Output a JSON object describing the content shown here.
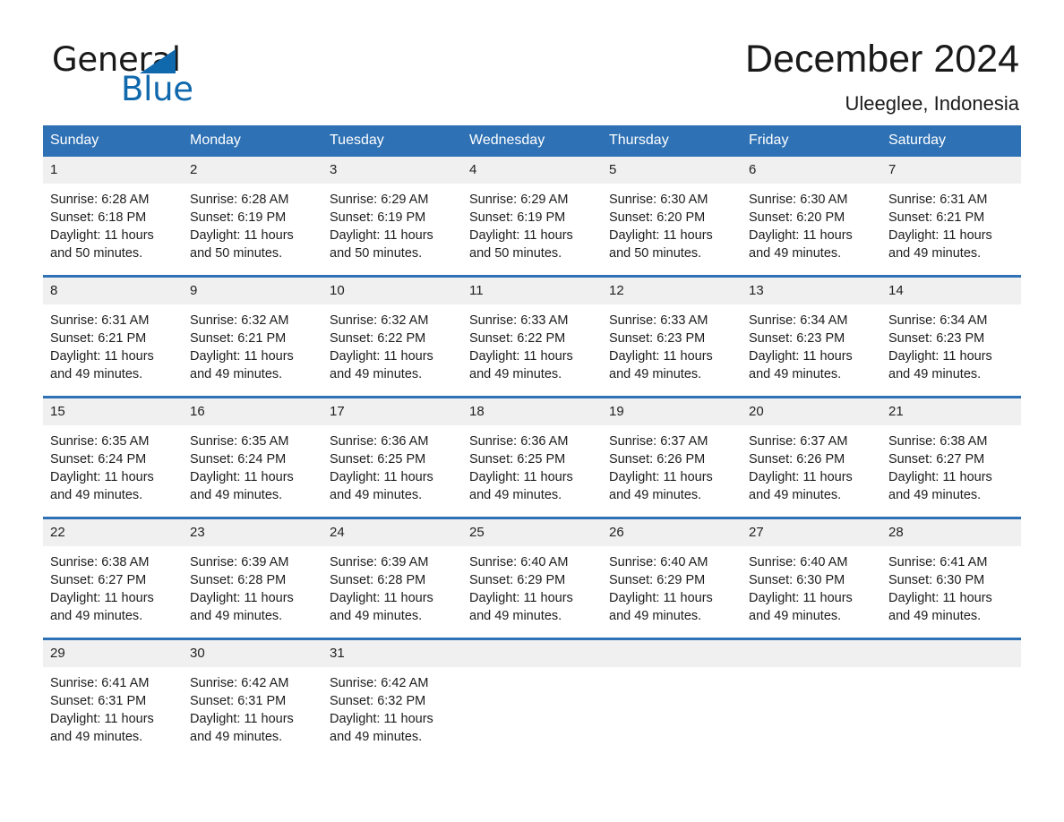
{
  "logo": {
    "word_one": "General",
    "word_two": "Blue",
    "triangle_color": "#1068ad"
  },
  "header": {
    "month_title": "December 2024",
    "location": "Uleeglee, Indonesia",
    "accent_color": "#2e71b5",
    "daynum_band_color": "#f0f0f0"
  },
  "weekdays": [
    "Sunday",
    "Monday",
    "Tuesday",
    "Wednesday",
    "Thursday",
    "Friday",
    "Saturday"
  ],
  "weeks": [
    [
      {
        "day": "1",
        "sunrise": "Sunrise: 6:28 AM",
        "sunset": "Sunset: 6:18 PM",
        "daylight_1": "Daylight: 11 hours",
        "daylight_2": "and 50 minutes."
      },
      {
        "day": "2",
        "sunrise": "Sunrise: 6:28 AM",
        "sunset": "Sunset: 6:19 PM",
        "daylight_1": "Daylight: 11 hours",
        "daylight_2": "and 50 minutes."
      },
      {
        "day": "3",
        "sunrise": "Sunrise: 6:29 AM",
        "sunset": "Sunset: 6:19 PM",
        "daylight_1": "Daylight: 11 hours",
        "daylight_2": "and 50 minutes."
      },
      {
        "day": "4",
        "sunrise": "Sunrise: 6:29 AM",
        "sunset": "Sunset: 6:19 PM",
        "daylight_1": "Daylight: 11 hours",
        "daylight_2": "and 50 minutes."
      },
      {
        "day": "5",
        "sunrise": "Sunrise: 6:30 AM",
        "sunset": "Sunset: 6:20 PM",
        "daylight_1": "Daylight: 11 hours",
        "daylight_2": "and 50 minutes."
      },
      {
        "day": "6",
        "sunrise": "Sunrise: 6:30 AM",
        "sunset": "Sunset: 6:20 PM",
        "daylight_1": "Daylight: 11 hours",
        "daylight_2": "and 49 minutes."
      },
      {
        "day": "7",
        "sunrise": "Sunrise: 6:31 AM",
        "sunset": "Sunset: 6:21 PM",
        "daylight_1": "Daylight: 11 hours",
        "daylight_2": "and 49 minutes."
      }
    ],
    [
      {
        "day": "8",
        "sunrise": "Sunrise: 6:31 AM",
        "sunset": "Sunset: 6:21 PM",
        "daylight_1": "Daylight: 11 hours",
        "daylight_2": "and 49 minutes."
      },
      {
        "day": "9",
        "sunrise": "Sunrise: 6:32 AM",
        "sunset": "Sunset: 6:21 PM",
        "daylight_1": "Daylight: 11 hours",
        "daylight_2": "and 49 minutes."
      },
      {
        "day": "10",
        "sunrise": "Sunrise: 6:32 AM",
        "sunset": "Sunset: 6:22 PM",
        "daylight_1": "Daylight: 11 hours",
        "daylight_2": "and 49 minutes."
      },
      {
        "day": "11",
        "sunrise": "Sunrise: 6:33 AM",
        "sunset": "Sunset: 6:22 PM",
        "daylight_1": "Daylight: 11 hours",
        "daylight_2": "and 49 minutes."
      },
      {
        "day": "12",
        "sunrise": "Sunrise: 6:33 AM",
        "sunset": "Sunset: 6:23 PM",
        "daylight_1": "Daylight: 11 hours",
        "daylight_2": "and 49 minutes."
      },
      {
        "day": "13",
        "sunrise": "Sunrise: 6:34 AM",
        "sunset": "Sunset: 6:23 PM",
        "daylight_1": "Daylight: 11 hours",
        "daylight_2": "and 49 minutes."
      },
      {
        "day": "14",
        "sunrise": "Sunrise: 6:34 AM",
        "sunset": "Sunset: 6:23 PM",
        "daylight_1": "Daylight: 11 hours",
        "daylight_2": "and 49 minutes."
      }
    ],
    [
      {
        "day": "15",
        "sunrise": "Sunrise: 6:35 AM",
        "sunset": "Sunset: 6:24 PM",
        "daylight_1": "Daylight: 11 hours",
        "daylight_2": "and 49 minutes."
      },
      {
        "day": "16",
        "sunrise": "Sunrise: 6:35 AM",
        "sunset": "Sunset: 6:24 PM",
        "daylight_1": "Daylight: 11 hours",
        "daylight_2": "and 49 minutes."
      },
      {
        "day": "17",
        "sunrise": "Sunrise: 6:36 AM",
        "sunset": "Sunset: 6:25 PM",
        "daylight_1": "Daylight: 11 hours",
        "daylight_2": "and 49 minutes."
      },
      {
        "day": "18",
        "sunrise": "Sunrise: 6:36 AM",
        "sunset": "Sunset: 6:25 PM",
        "daylight_1": "Daylight: 11 hours",
        "daylight_2": "and 49 minutes."
      },
      {
        "day": "19",
        "sunrise": "Sunrise: 6:37 AM",
        "sunset": "Sunset: 6:26 PM",
        "daylight_1": "Daylight: 11 hours",
        "daylight_2": "and 49 minutes."
      },
      {
        "day": "20",
        "sunrise": "Sunrise: 6:37 AM",
        "sunset": "Sunset: 6:26 PM",
        "daylight_1": "Daylight: 11 hours",
        "daylight_2": "and 49 minutes."
      },
      {
        "day": "21",
        "sunrise": "Sunrise: 6:38 AM",
        "sunset": "Sunset: 6:27 PM",
        "daylight_1": "Daylight: 11 hours",
        "daylight_2": "and 49 minutes."
      }
    ],
    [
      {
        "day": "22",
        "sunrise": "Sunrise: 6:38 AM",
        "sunset": "Sunset: 6:27 PM",
        "daylight_1": "Daylight: 11 hours",
        "daylight_2": "and 49 minutes."
      },
      {
        "day": "23",
        "sunrise": "Sunrise: 6:39 AM",
        "sunset": "Sunset: 6:28 PM",
        "daylight_1": "Daylight: 11 hours",
        "daylight_2": "and 49 minutes."
      },
      {
        "day": "24",
        "sunrise": "Sunrise: 6:39 AM",
        "sunset": "Sunset: 6:28 PM",
        "daylight_1": "Daylight: 11 hours",
        "daylight_2": "and 49 minutes."
      },
      {
        "day": "25",
        "sunrise": "Sunrise: 6:40 AM",
        "sunset": "Sunset: 6:29 PM",
        "daylight_1": "Daylight: 11 hours",
        "daylight_2": "and 49 minutes."
      },
      {
        "day": "26",
        "sunrise": "Sunrise: 6:40 AM",
        "sunset": "Sunset: 6:29 PM",
        "daylight_1": "Daylight: 11 hours",
        "daylight_2": "and 49 minutes."
      },
      {
        "day": "27",
        "sunrise": "Sunrise: 6:40 AM",
        "sunset": "Sunset: 6:30 PM",
        "daylight_1": "Daylight: 11 hours",
        "daylight_2": "and 49 minutes."
      },
      {
        "day": "28",
        "sunrise": "Sunrise: 6:41 AM",
        "sunset": "Sunset: 6:30 PM",
        "daylight_1": "Daylight: 11 hours",
        "daylight_2": "and 49 minutes."
      }
    ],
    [
      {
        "day": "29",
        "sunrise": "Sunrise: 6:41 AM",
        "sunset": "Sunset: 6:31 PM",
        "daylight_1": "Daylight: 11 hours",
        "daylight_2": "and 49 minutes."
      },
      {
        "day": "30",
        "sunrise": "Sunrise: 6:42 AM",
        "sunset": "Sunset: 6:31 PM",
        "daylight_1": "Daylight: 11 hours",
        "daylight_2": "and 49 minutes."
      },
      {
        "day": "31",
        "sunrise": "Sunrise: 6:42 AM",
        "sunset": "Sunset: 6:32 PM",
        "daylight_1": "Daylight: 11 hours",
        "daylight_2": "and 49 minutes."
      },
      {
        "day": "",
        "sunrise": "",
        "sunset": "",
        "daylight_1": "",
        "daylight_2": ""
      },
      {
        "day": "",
        "sunrise": "",
        "sunset": "",
        "daylight_1": "",
        "daylight_2": ""
      },
      {
        "day": "",
        "sunrise": "",
        "sunset": "",
        "daylight_1": "",
        "daylight_2": ""
      },
      {
        "day": "",
        "sunrise": "",
        "sunset": "",
        "daylight_1": "",
        "daylight_2": ""
      }
    ]
  ]
}
